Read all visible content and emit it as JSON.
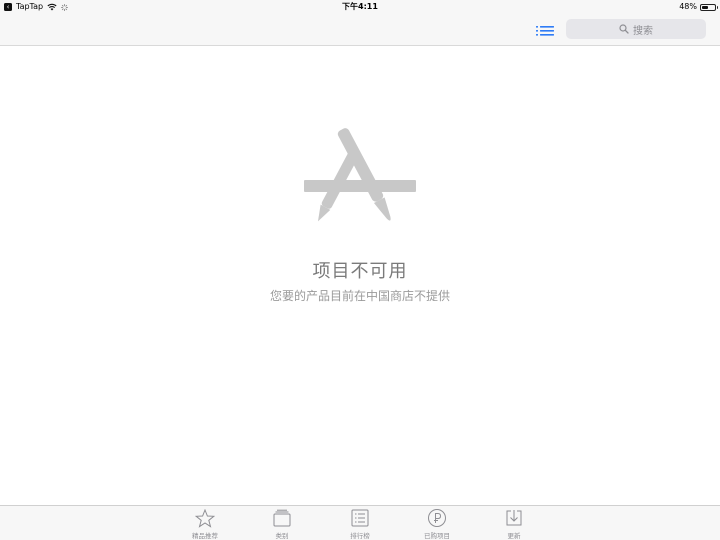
{
  "status_bar": {
    "app_back": "TapTap",
    "time": "下午4:11",
    "battery_percent": "48%",
    "battery_level": 0.48
  },
  "nav": {
    "search_placeholder": "搜索",
    "accent_color": "#2f7cf6"
  },
  "empty_state": {
    "title": "项目不可用",
    "subtitle": "您要的产品目前在中国商店不提供",
    "icon": "app-store-icon",
    "icon_color": "#c8c8c8"
  },
  "tab_bar": {
    "items": [
      {
        "label": "精品推荐",
        "icon": "star-icon"
      },
      {
        "label": "类别",
        "icon": "categories-icon"
      },
      {
        "label": "排行榜",
        "icon": "top-charts-icon"
      },
      {
        "label": "已购项目",
        "icon": "purchased-icon"
      },
      {
        "label": "更新",
        "icon": "updates-icon"
      }
    ]
  }
}
